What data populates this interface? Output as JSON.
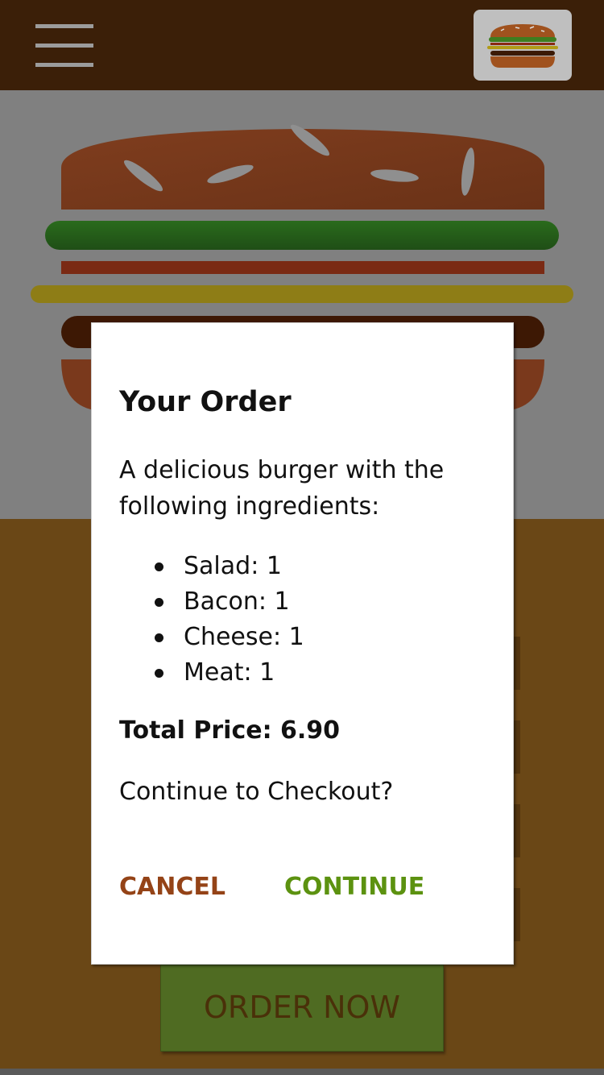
{
  "toolbar": {
    "menu_icon": "hamburger-menu-icon",
    "logo_icon": "burger-logo-icon"
  },
  "preview": {
    "background_color": "#808080",
    "ingredients_shown": [
      "Salad",
      "Bacon",
      "Cheese",
      "Meat"
    ]
  },
  "modal": {
    "title": "Your Order",
    "description": "A delicious burger with the following ingredients:",
    "ingredients": [
      "Salad: 1",
      "Bacon: 1",
      "Cheese: 1",
      "Meat: 1"
    ],
    "total_price": "Total Price: 6.90",
    "question": "Continue to Checkout?",
    "cancel_label": "CANCEL",
    "continue_label": "CONTINUE"
  },
  "order_button": {
    "label": "ORDER NOW"
  },
  "colors": {
    "toolbar": "#3b1f08",
    "controls_background": "#6a4716",
    "cancel": "#944317",
    "continue": "#5c9210",
    "order_button": "#4f6b22"
  }
}
